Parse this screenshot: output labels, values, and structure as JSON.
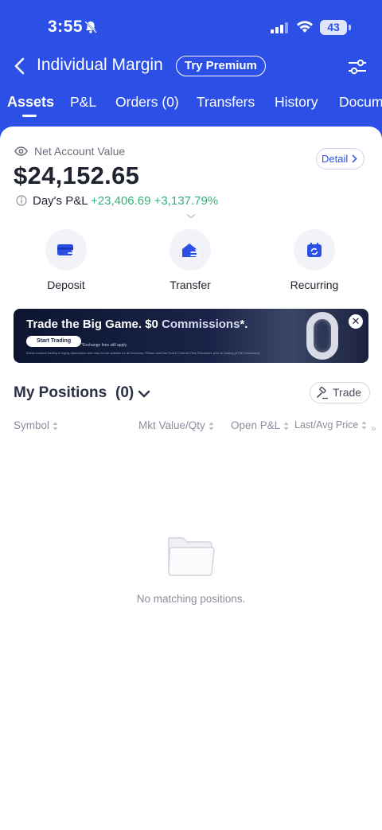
{
  "status_bar": {
    "time": "3:55",
    "battery": "43"
  },
  "header": {
    "title": "Individual Margin",
    "premium_label": "Try Premium"
  },
  "tabs": [
    {
      "label": "Assets",
      "active": true
    },
    {
      "label": "P&L",
      "active": false
    },
    {
      "label": "Orders (0)",
      "active": false
    },
    {
      "label": "Transfers",
      "active": false
    },
    {
      "label": "History",
      "active": false
    },
    {
      "label": "Docum",
      "active": false
    }
  ],
  "account": {
    "net_value_label": "Net Account Value",
    "net_value": "$24,152.65",
    "detail_label": "Detail",
    "day_pl_label": "Day's P&L",
    "day_pl_value": "+23,406.69 +3,137.79%"
  },
  "actions": [
    {
      "label": "Deposit",
      "icon": "deposit-icon"
    },
    {
      "label": "Transfer",
      "icon": "transfer-icon"
    },
    {
      "label": "Recurring",
      "icon": "recurring-icon"
    }
  ],
  "banner": {
    "title_main": "Trade the Big Game. $0 ",
    "title_highlight": "Commissions",
    "title_suffix": "*.",
    "button": "Start Trading",
    "fee_note": "*Exchange fees still apply.",
    "disclaimer": "Event contract trading is highly speculative and may not be suitable for all investors. Please read the Event Contract Risk Disclosure prior to trading (9736 Disclosure).",
    "big_text": "0"
  },
  "positions": {
    "title": "My Positions",
    "count": "(0)",
    "trade_label": "Trade",
    "columns": [
      "Symbol",
      "Mkt Value/Qty",
      "Open P&L",
      "Last/Avg Price"
    ],
    "more": "»",
    "empty_text": "No matching positions."
  },
  "colors": {
    "brand": "#2c4fe6",
    "gain": "#33b07c"
  }
}
